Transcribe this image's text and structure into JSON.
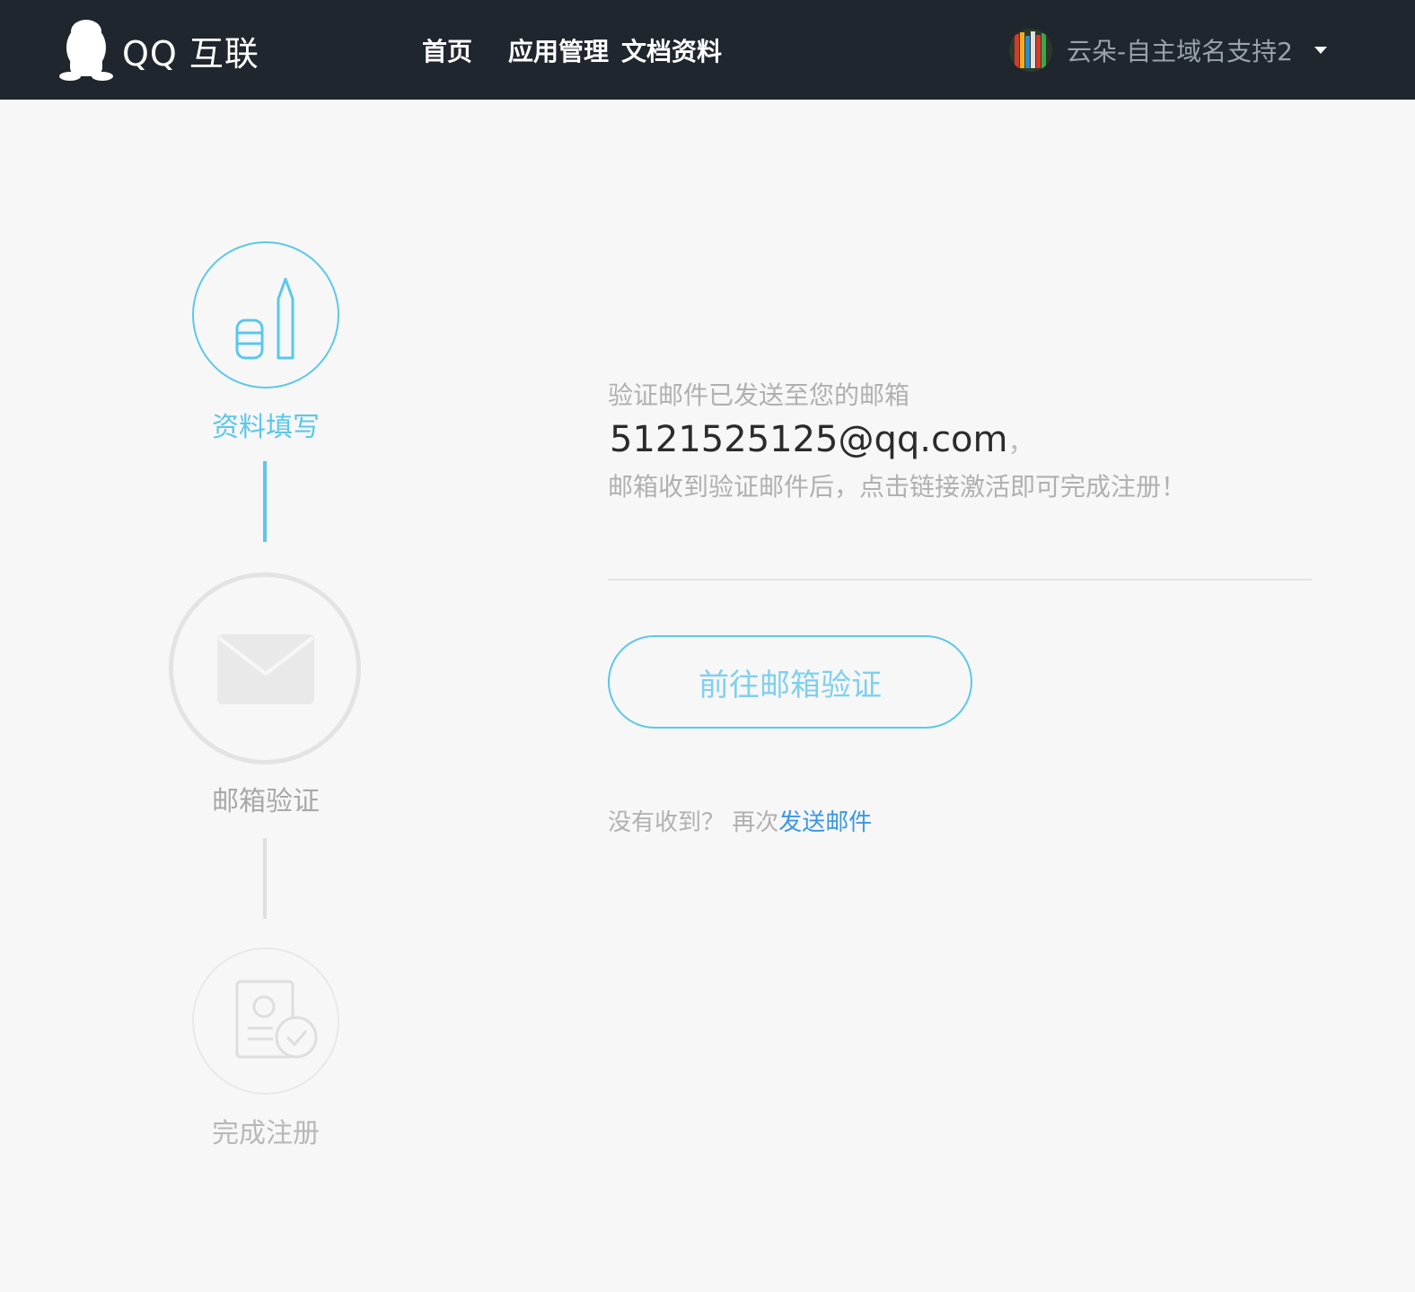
{
  "header": {
    "logo_text": "QQ 互联",
    "nav": [
      "首页",
      "应用管理",
      "文档资料"
    ],
    "user_name": "云朵-自主域名支持2"
  },
  "steps": [
    {
      "label": "资料填写",
      "state": "done"
    },
    {
      "label": "邮箱验证",
      "state": "current"
    },
    {
      "label": "完成注册",
      "state": "pending"
    }
  ],
  "content": {
    "line1": "验证邮件已发送至您的邮箱",
    "email": "5121525125@qq.com",
    "email_separator": "，",
    "line3": "邮箱收到验证邮件后，点击链接激活即可完成注册！",
    "button_label": "前往邮箱验证",
    "resend_prefix": "没有收到？ 再次",
    "resend_link": "发送邮件"
  },
  "colors": {
    "header_bg": "#1f262d",
    "accent": "#5ac8ea",
    "link": "#3a97e5",
    "page_bg": "#f7f7f7"
  },
  "icons": {
    "logo": "qq-penguin-icon",
    "step1": "pen-icon",
    "step2": "envelope-icon",
    "step3": "id-card-check-icon",
    "user_menu": "caret-down-icon"
  }
}
